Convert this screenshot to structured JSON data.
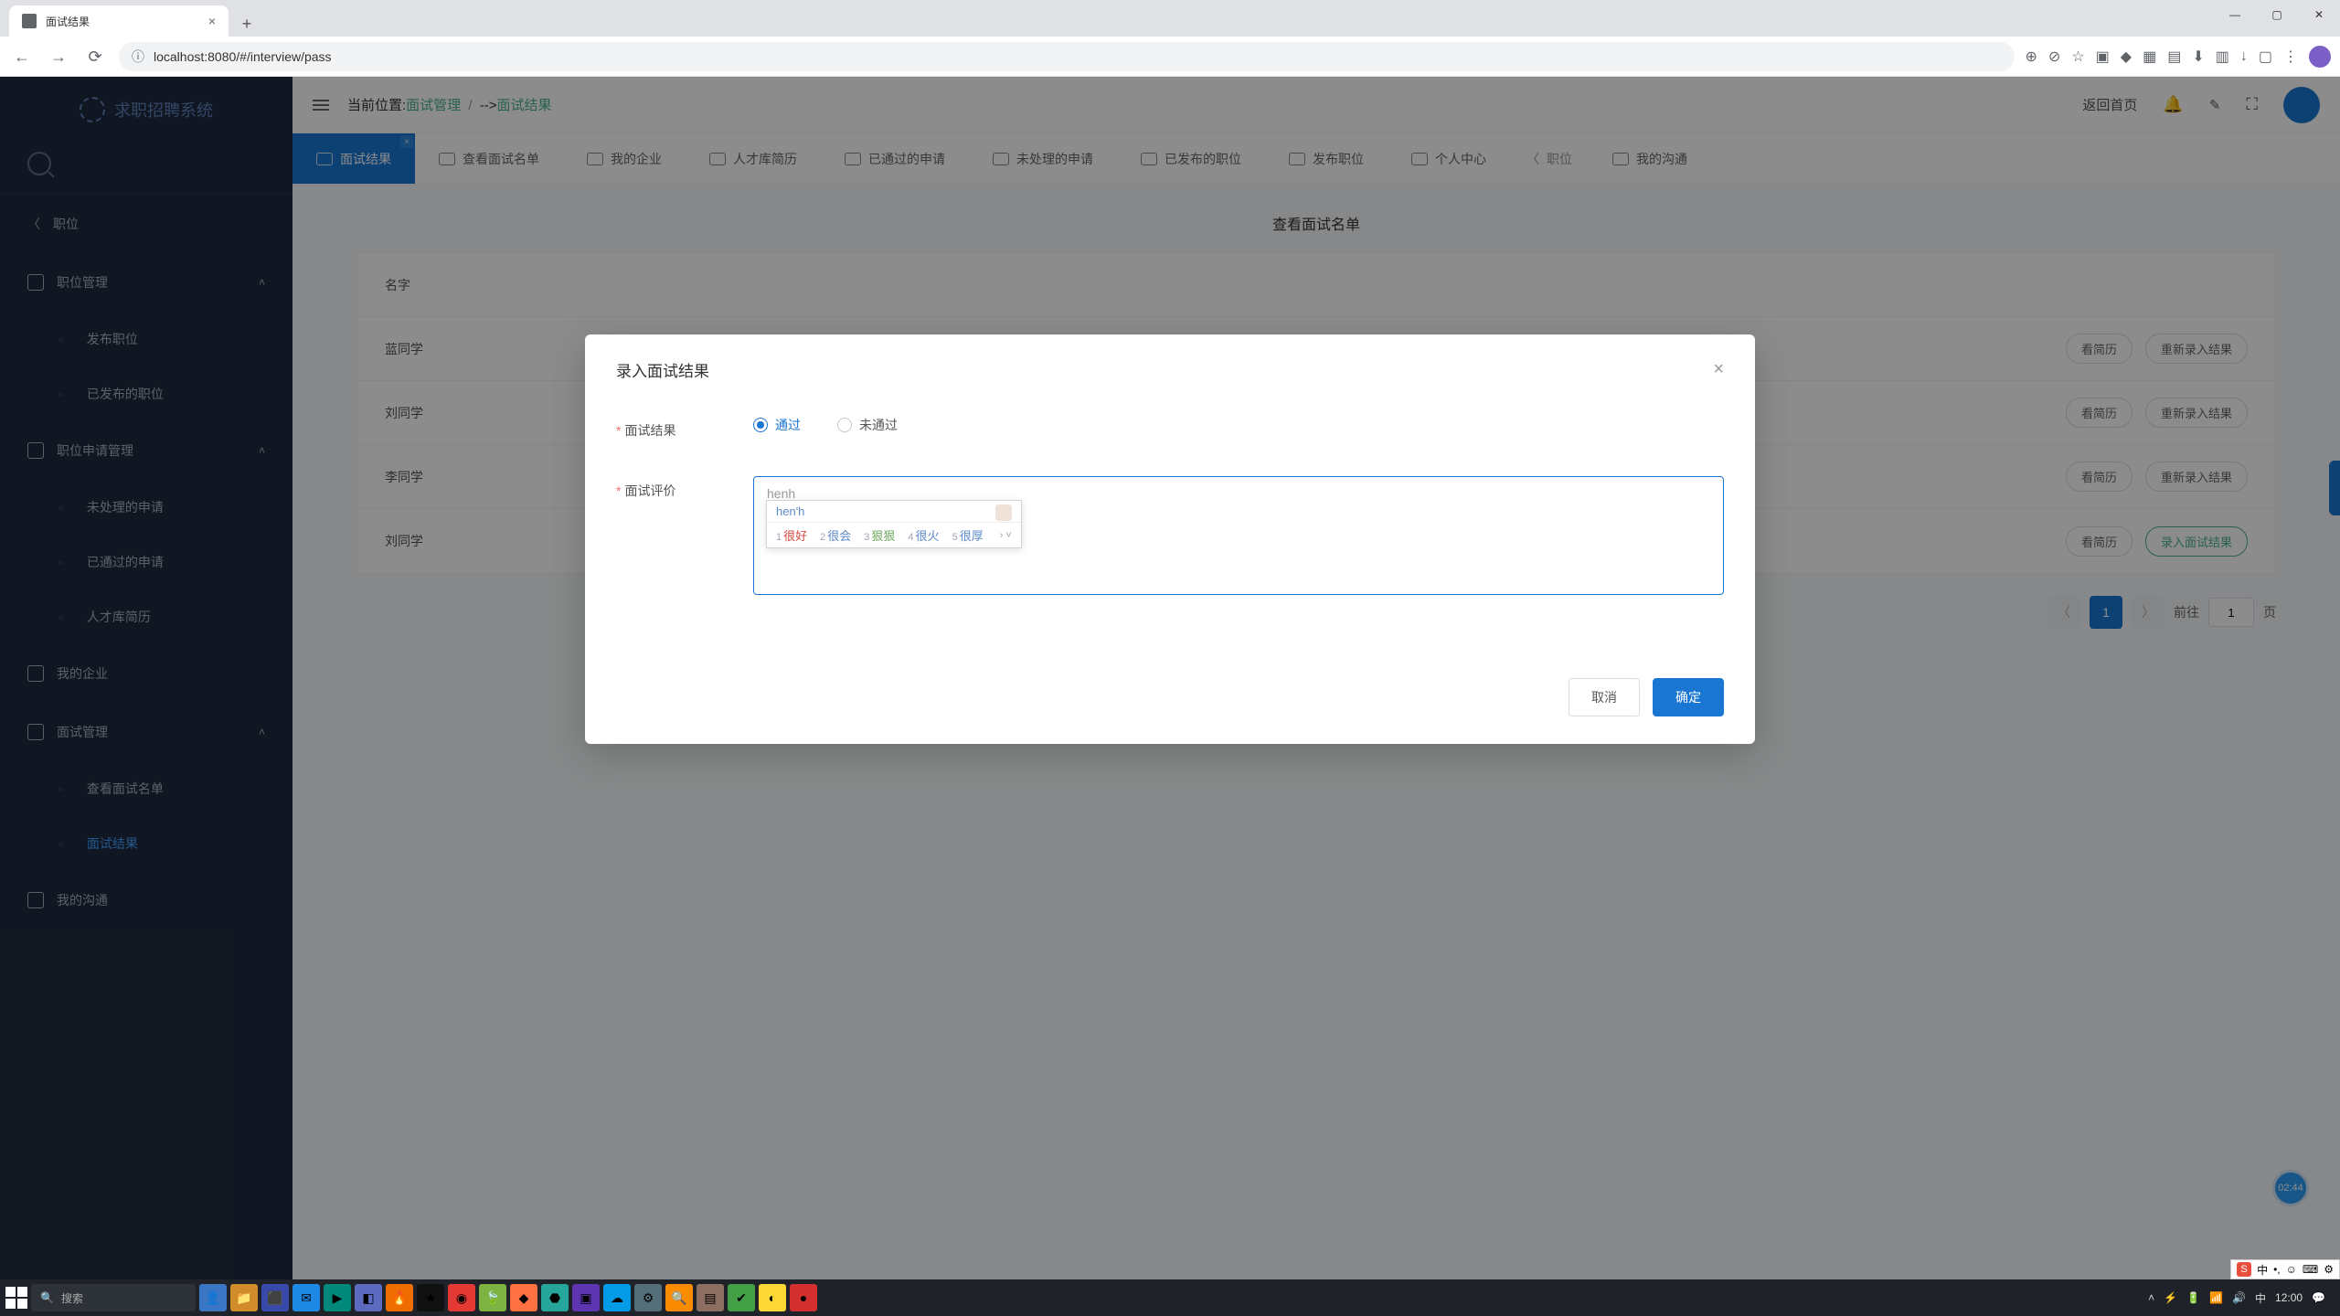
{
  "browser": {
    "tab_title": "面试结果",
    "url": "localhost:8080/#/interview/pass"
  },
  "sidebar": {
    "logo": "求职招聘系统",
    "back_label": "职位",
    "groups": [
      {
        "label": "职位管理",
        "children": [
          {
            "label": "发布职位"
          },
          {
            "label": "已发布的职位"
          }
        ]
      },
      {
        "label": "职位申请管理",
        "children": [
          {
            "label": "未处理的申请"
          },
          {
            "label": "已通过的申请"
          },
          {
            "label": "人才库简历"
          }
        ]
      },
      {
        "label": "我的企业"
      },
      {
        "label": "面试管理",
        "children": [
          {
            "label": "查看面试名单"
          },
          {
            "label": "面试结果",
            "active": true
          }
        ]
      },
      {
        "label": "我的沟通"
      }
    ]
  },
  "topbar": {
    "loc_prefix": "当前位置:",
    "crumb1": "面试管理",
    "arrow": "-->",
    "crumb2": "面试结果",
    "home": "返回首页"
  },
  "tabs": [
    {
      "label": "面试结果",
      "active": true
    },
    {
      "label": "查看面试名单"
    },
    {
      "label": "我的企业"
    },
    {
      "label": "人才库简历"
    },
    {
      "label": "已通过的申请"
    },
    {
      "label": "未处理的申请"
    },
    {
      "label": "已发布的职位"
    },
    {
      "label": "发布职位"
    },
    {
      "label": "个人中心"
    }
  ],
  "tab_arrow_left": "职位",
  "tab_arrow_right": "我的沟通",
  "panel": {
    "title": "查看面试名单",
    "header_name": "名字",
    "rows": [
      {
        "name": "蓝同学",
        "btn1": "看简历",
        "btn2": "重新录入结果"
      },
      {
        "name": "刘同学",
        "btn1": "看简历",
        "btn2": "重新录入结果"
      },
      {
        "name": "李同学",
        "btn1": "看简历",
        "btn2": "重新录入结果"
      },
      {
        "name": "刘同学",
        "btn1": "看简历",
        "btn2": "录入面试结果",
        "green": true
      }
    ],
    "pagination": {
      "current": "1",
      "goto_label": "前往",
      "goto_value": "1",
      "page_suffix": "页"
    }
  },
  "modal": {
    "title": "录入面试结果",
    "field_result": "面试结果",
    "opt_pass": "通过",
    "opt_fail": "未通过",
    "field_eval": "面试评价",
    "textarea_value": "henh",
    "ime_input": "hen'h",
    "ime_candidates": [
      {
        "n": "1",
        "t": "很好"
      },
      {
        "n": "2",
        "t": "很会"
      },
      {
        "n": "3",
        "t": "狠狠"
      },
      {
        "n": "4",
        "t": "很火"
      },
      {
        "n": "5",
        "t": "很厚"
      }
    ],
    "cancel": "取消",
    "ok": "确定"
  },
  "rec_badge": "02:44",
  "taskbar": {
    "search_placeholder": "搜索",
    "time": "12:00",
    "pinyin": "中"
  }
}
